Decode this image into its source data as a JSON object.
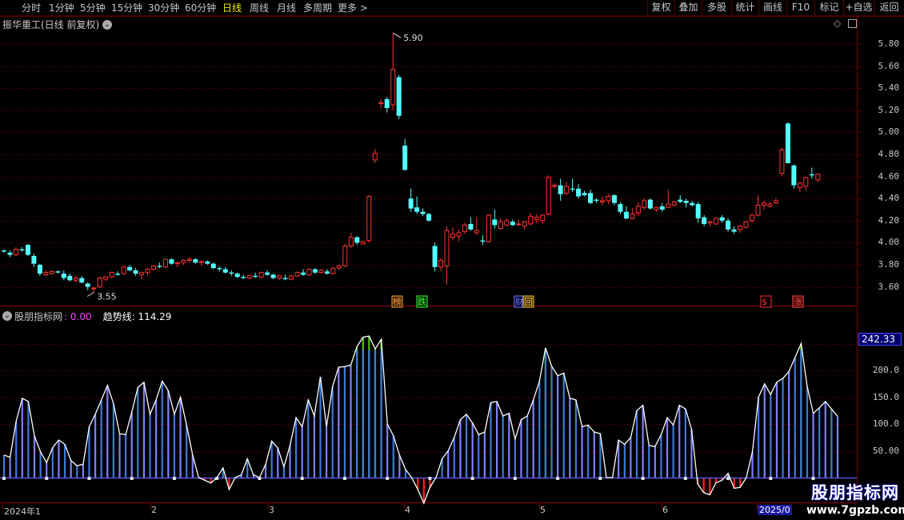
{
  "toolbar": {
    "periods": [
      "分时",
      "1分钟",
      "5分钟",
      "15分钟",
      "30分钟",
      "60分钟",
      "日线",
      "周线",
      "月线",
      "多周期",
      "更多 >"
    ],
    "active_period": "日线",
    "right_buttons": [
      "复权",
      "叠加",
      "多股",
      "统计",
      "画线",
      "F10",
      "标记",
      "+自选",
      "返回"
    ]
  },
  "main_chart": {
    "title": "振华重工(日线 前复权)",
    "price_high_label": "5.90",
    "price_low_label": "3.55",
    "y_ticks": [
      "5.80",
      "5.60",
      "5.40",
      "5.20",
      "5.00",
      "4.80",
      "4.60",
      "4.40",
      "4.20",
      "4.00",
      "3.80",
      "3.60"
    ],
    "event_flags": [
      "榜",
      "跌",
      "财",
      "回",
      "$",
      "涨"
    ]
  },
  "indicator": {
    "name": "股朋指标网",
    "value": ": 0.00",
    "trend_label": "趋势线: 114.29",
    "current_value_tag": "242.33",
    "y_ticks": [
      "200.0",
      "150.0",
      "100.0",
      "50.00"
    ]
  },
  "date_axis": {
    "labels": [
      "2024年1",
      "2",
      "3",
      "4",
      "5",
      "6",
      "2025/0"
    ]
  },
  "watermark": {
    "title": "股朋指标网",
    "url": "www.7gpzb.com"
  },
  "colors": {
    "up": "#ff3232",
    "down": "#54ffff",
    "bar_blue": "#3d7ad8",
    "bar_violet": "#8080ff",
    "bar_green": "#52c41a",
    "bar_red": "#ff2020",
    "trend_line": "#ffffff",
    "active": "#f0f000",
    "grid": "#7a0000"
  },
  "chart_data": [
    {
      "type": "candlestick",
      "title": "振华重工(日线 前复权)",
      "ylim": [
        3.5,
        5.95
      ],
      "annotations": {
        "high": 5.9,
        "low": 3.55
      },
      "ohlc": [
        [
          3.93,
          3.94,
          3.91,
          3.92
        ],
        [
          3.91,
          3.93,
          3.87,
          3.89
        ],
        [
          3.89,
          3.96,
          3.88,
          3.94
        ],
        [
          3.94,
          3.96,
          3.92,
          3.93
        ],
        [
          3.98,
          3.99,
          3.88,
          3.89
        ],
        [
          3.88,
          3.9,
          3.78,
          3.81
        ],
        [
          3.8,
          3.81,
          3.7,
          3.72
        ],
        [
          3.71,
          3.75,
          3.7,
          3.73
        ],
        [
          3.72,
          3.75,
          3.71,
          3.74
        ],
        [
          3.74,
          3.75,
          3.72,
          3.73
        ],
        [
          3.72,
          3.75,
          3.66,
          3.68
        ],
        [
          3.7,
          3.72,
          3.65,
          3.66
        ],
        [
          3.66,
          3.7,
          3.64,
          3.68
        ],
        [
          3.68,
          3.7,
          3.63,
          3.64
        ],
        [
          3.63,
          3.64,
          3.57,
          3.6
        ],
        [
          3.59,
          3.6,
          3.55,
          3.59
        ],
        [
          3.6,
          3.69,
          3.59,
          3.68
        ],
        [
          3.67,
          3.7,
          3.65,
          3.69
        ],
        [
          3.69,
          3.74,
          3.68,
          3.73
        ],
        [
          3.72,
          3.74,
          3.7,
          3.71
        ],
        [
          3.72,
          3.79,
          3.71,
          3.78
        ],
        [
          3.78,
          3.8,
          3.74,
          3.75
        ],
        [
          3.75,
          3.77,
          3.7,
          3.72
        ],
        [
          3.71,
          3.74,
          3.67,
          3.73
        ],
        [
          3.73,
          3.77,
          3.7,
          3.76
        ],
        [
          3.76,
          3.8,
          3.75,
          3.79
        ],
        [
          3.79,
          3.82,
          3.77,
          3.78
        ],
        [
          3.78,
          3.86,
          3.77,
          3.85
        ],
        [
          3.85,
          3.86,
          3.8,
          3.81
        ],
        [
          3.81,
          3.83,
          3.78,
          3.82
        ],
        [
          3.82,
          3.85,
          3.8,
          3.84
        ],
        [
          3.84,
          3.87,
          3.82,
          3.85
        ],
        [
          3.85,
          3.86,
          3.81,
          3.82
        ],
        [
          3.82,
          3.84,
          3.79,
          3.83
        ],
        [
          3.83,
          3.84,
          3.8,
          3.81
        ],
        [
          3.81,
          3.82,
          3.76,
          3.77
        ],
        [
          3.77,
          3.79,
          3.74,
          3.76
        ],
        [
          3.76,
          3.78,
          3.72,
          3.73
        ],
        [
          3.73,
          3.75,
          3.7,
          3.72
        ],
        [
          3.72,
          3.73,
          3.68,
          3.69
        ],
        [
          3.69,
          3.71,
          3.67,
          3.68
        ],
        [
          3.68,
          3.71,
          3.67,
          3.7
        ],
        [
          3.7,
          3.73,
          3.68,
          3.69
        ],
        [
          3.69,
          3.74,
          3.68,
          3.73
        ],
        [
          3.73,
          3.75,
          3.7,
          3.71
        ],
        [
          3.71,
          3.72,
          3.67,
          3.68
        ],
        [
          3.68,
          3.71,
          3.66,
          3.7
        ],
        [
          3.68,
          3.71,
          3.66,
          3.67
        ],
        [
          3.67,
          3.71,
          3.66,
          3.7
        ],
        [
          3.7,
          3.74,
          3.69,
          3.73
        ],
        [
          3.73,
          3.76,
          3.7,
          3.71
        ],
        [
          3.71,
          3.77,
          3.7,
          3.76
        ],
        [
          3.76,
          3.77,
          3.72,
          3.73
        ],
        [
          3.73,
          3.76,
          3.72,
          3.75
        ],
        [
          3.74,
          3.76,
          3.71,
          3.72
        ],
        [
          3.72,
          3.78,
          3.71,
          3.77
        ],
        [
          3.77,
          3.8,
          3.75,
          3.79
        ],
        [
          3.79,
          3.99,
          3.78,
          3.97
        ],
        [
          3.97,
          4.09,
          3.95,
          4.05
        ],
        [
          4.05,
          4.06,
          3.98,
          4.0
        ],
        [
          3.99,
          4.02,
          3.98,
          4.01
        ],
        [
          4.02,
          4.43,
          4.0,
          4.42
        ],
        [
          4.75,
          4.85,
          4.72,
          4.81
        ],
        [
          5.26,
          5.3,
          5.22,
          5.27
        ],
        [
          5.3,
          5.32,
          5.18,
          5.22
        ],
        [
          5.25,
          5.9,
          5.2,
          5.57
        ],
        [
          5.5,
          5.52,
          5.12,
          5.15
        ],
        [
          4.88,
          4.94,
          4.65,
          4.66
        ],
        [
          4.4,
          4.49,
          4.28,
          4.31
        ],
        [
          4.32,
          4.42,
          4.26,
          4.28
        ],
        [
          4.28,
          4.31,
          4.24,
          4.26
        ],
        [
          4.26,
          4.27,
          4.19,
          4.2
        ],
        [
          3.97,
          4.0,
          3.74,
          3.78
        ],
        [
          3.78,
          3.86,
          3.74,
          3.84
        ],
        [
          3.79,
          4.15,
          3.62,
          4.11
        ],
        [
          4.05,
          4.14,
          4.02,
          4.08
        ],
        [
          4.06,
          4.12,
          4.01,
          4.09
        ],
        [
          4.1,
          4.18,
          4.08,
          4.16
        ],
        [
          4.17,
          4.23,
          4.11,
          4.12
        ],
        [
          4.09,
          4.23,
          4.07,
          4.11
        ],
        [
          4.02,
          4.07,
          3.98,
          4.01
        ],
        [
          4.01,
          4.26,
          4.0,
          4.25
        ],
        [
          4.21,
          4.3,
          4.13,
          4.16
        ],
        [
          4.13,
          4.22,
          4.12,
          4.19
        ],
        [
          4.16,
          4.22,
          4.15,
          4.2
        ],
        [
          4.19,
          4.21,
          4.15,
          4.16
        ],
        [
          4.17,
          4.21,
          4.15,
          4.17
        ],
        [
          4.15,
          4.2,
          4.12,
          4.19
        ],
        [
          4.17,
          4.27,
          4.16,
          4.24
        ],
        [
          4.21,
          4.26,
          4.18,
          4.23
        ],
        [
          4.2,
          4.26,
          4.17,
          4.25
        ],
        [
          4.26,
          4.61,
          4.25,
          4.59
        ],
        [
          4.51,
          4.54,
          4.49,
          4.52
        ],
        [
          4.52,
          4.58,
          4.38,
          4.44
        ],
        [
          4.45,
          4.55,
          4.43,
          4.51
        ],
        [
          4.49,
          4.58,
          4.46,
          4.48
        ],
        [
          4.49,
          4.53,
          4.4,
          4.42
        ],
        [
          4.45,
          4.47,
          4.42,
          4.43
        ],
        [
          4.45,
          4.48,
          4.35,
          4.36
        ],
        [
          4.39,
          4.4,
          4.36,
          4.38
        ],
        [
          4.37,
          4.42,
          4.34,
          4.38
        ],
        [
          4.38,
          4.44,
          4.35,
          4.42
        ],
        [
          4.43,
          4.44,
          4.34,
          4.36
        ],
        [
          4.35,
          4.37,
          4.26,
          4.28
        ],
        [
          4.28,
          4.33,
          4.21,
          4.22
        ],
        [
          4.22,
          4.31,
          4.21,
          4.26
        ],
        [
          4.27,
          4.37,
          4.24,
          4.33
        ],
        [
          4.32,
          4.4,
          4.3,
          4.38
        ],
        [
          4.39,
          4.4,
          4.3,
          4.31
        ],
        [
          4.3,
          4.33,
          4.28,
          4.32
        ],
        [
          4.33,
          4.36,
          4.28,
          4.3
        ],
        [
          4.32,
          4.48,
          4.32,
          4.35
        ],
        [
          4.34,
          4.38,
          4.33,
          4.37
        ],
        [
          4.39,
          4.43,
          4.36,
          4.37
        ],
        [
          4.38,
          4.4,
          4.32,
          4.36
        ],
        [
          4.36,
          4.38,
          4.33,
          4.34
        ],
        [
          4.35,
          4.37,
          4.18,
          4.22
        ],
        [
          4.23,
          4.25,
          4.15,
          4.17
        ],
        [
          4.18,
          4.2,
          4.15,
          4.19
        ],
        [
          4.17,
          4.23,
          4.16,
          4.22
        ],
        [
          4.23,
          4.25,
          4.18,
          4.2
        ],
        [
          4.2,
          4.22,
          4.1,
          4.12
        ],
        [
          4.12,
          4.15,
          4.08,
          4.1
        ],
        [
          4.12,
          4.16,
          4.09,
          4.15
        ],
        [
          4.14,
          4.2,
          4.13,
          4.19
        ],
        [
          4.2,
          4.26,
          4.18,
          4.25
        ],
        [
          4.25,
          4.43,
          4.24,
          4.34
        ],
        [
          4.34,
          4.38,
          4.3,
          4.36
        ],
        [
          4.33,
          4.37,
          4.32,
          4.35
        ],
        [
          4.36,
          4.4,
          4.35,
          4.38
        ],
        [
          4.63,
          4.86,
          4.6,
          4.84
        ],
        [
          5.08,
          5.09,
          4.72,
          4.72
        ],
        [
          4.7,
          4.71,
          4.49,
          4.52
        ],
        [
          4.5,
          4.55,
          4.46,
          4.54
        ],
        [
          4.51,
          4.6,
          4.47,
          4.59
        ],
        [
          4.62,
          4.68,
          4.58,
          4.61
        ],
        [
          4.57,
          4.63,
          4.55,
          4.62
        ]
      ]
    },
    {
      "type": "bar",
      "title": "股朋指标网",
      "ylim": [
        -50,
        270
      ],
      "trend_line_last": 114.29,
      "current_value": 242.33,
      "values": [
        42,
        38,
        105,
        148,
        142,
        78,
        48,
        28,
        56,
        70,
        62,
        32,
        22,
        25,
        95,
        118,
        145,
        172,
        138,
        82,
        80,
        122,
        168,
        178,
        118,
        145,
        180,
        162,
        118,
        150,
        98,
        42,
        0,
        -5,
        -10,
        0,
        18,
        -22,
        0,
        5,
        35,
        5,
        0,
        25,
        68,
        55,
        20,
        60,
        112,
        95,
        145,
        115,
        188,
        95,
        170,
        206,
        207,
        210,
        244,
        262,
        264,
        240,
        258,
        100,
        78,
        42,
        15,
        0,
        -22,
        -48,
        -18,
        0,
        35,
        50,
        75,
        108,
        118,
        102,
        80,
        85,
        140,
        142,
        115,
        120,
        72,
        108,
        115,
        145,
        180,
        242,
        208,
        190,
        195,
        148,
        145,
        95,
        98,
        85,
        82,
        0,
        0,
        70,
        62,
        75,
        125,
        135,
        60,
        58,
        80,
        112,
        98,
        135,
        128,
        90,
        -12,
        -28,
        -32,
        -10,
        -5,
        8,
        -20,
        -18,
        0,
        48,
        150,
        175,
        155,
        178,
        185,
        198,
        224,
        250,
        170,
        120,
        130,
        142,
        128,
        114
      ]
    }
  ]
}
